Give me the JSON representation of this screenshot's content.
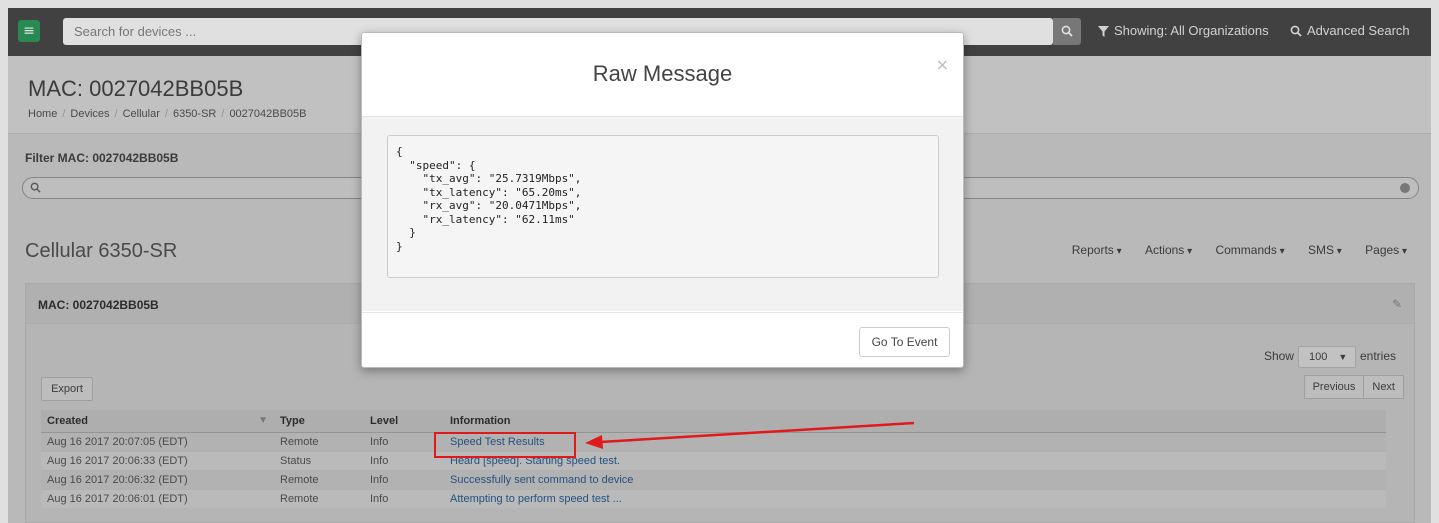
{
  "topbar": {
    "search_placeholder": "Search for devices ...",
    "showing_label": "Showing: All Organizations",
    "advanced_search_label": "Advanced Search"
  },
  "header": {
    "title": "MAC: 0027042BB05B",
    "breadcrumb": [
      "Home",
      "Devices",
      "Cellular",
      "6350-SR",
      "0027042BB05B"
    ]
  },
  "filter": {
    "label": "Filter MAC: 0027042BB05B"
  },
  "section": {
    "title": "Cellular 6350-SR",
    "menus": [
      "Reports",
      "Actions",
      "Commands",
      "SMS",
      "Pages"
    ]
  },
  "panel": {
    "title": "MAC: 0027042BB05B",
    "show_label": "Show",
    "entries_value": "100",
    "entries_label": "entries",
    "export_label": "Export",
    "previous_label": "Previous",
    "next_label": "Next"
  },
  "table": {
    "columns": [
      "Created",
      "Type",
      "Level",
      "Information"
    ],
    "rows": [
      {
        "created": "Aug 16 2017 20:07:05 (EDT)",
        "type": "Remote",
        "level": "Info",
        "information": "Speed Test Results"
      },
      {
        "created": "Aug 16 2017 20:06:33 (EDT)",
        "type": "Status",
        "level": "Info",
        "information": "Heard [speed]. Starting speed test."
      },
      {
        "created": "Aug 16 2017 20:06:32 (EDT)",
        "type": "Remote",
        "level": "Info",
        "information": "Successfully sent command to device"
      },
      {
        "created": "Aug 16 2017 20:06:01 (EDT)",
        "type": "Remote",
        "level": "Info",
        "information": "Attempting to perform speed test ..."
      }
    ]
  },
  "modal": {
    "title": "Raw Message",
    "close_symbol": "×",
    "json_lines": [
      "{",
      "  \"speed\": {",
      "    \"tx_avg\": \"25.7319Mbps\",",
      "    \"tx_latency\": \"65.20ms\",",
      "    \"rx_avg\": \"20.0471Mbps\",",
      "    \"rx_latency\": \"62.11ms\"",
      "  }",
      "}"
    ],
    "goto_label": "Go To Event"
  },
  "colors": {
    "annotation_red": "#e0191b",
    "brand_green": "#2e9c5e",
    "link_blue": "#2a5d94"
  }
}
